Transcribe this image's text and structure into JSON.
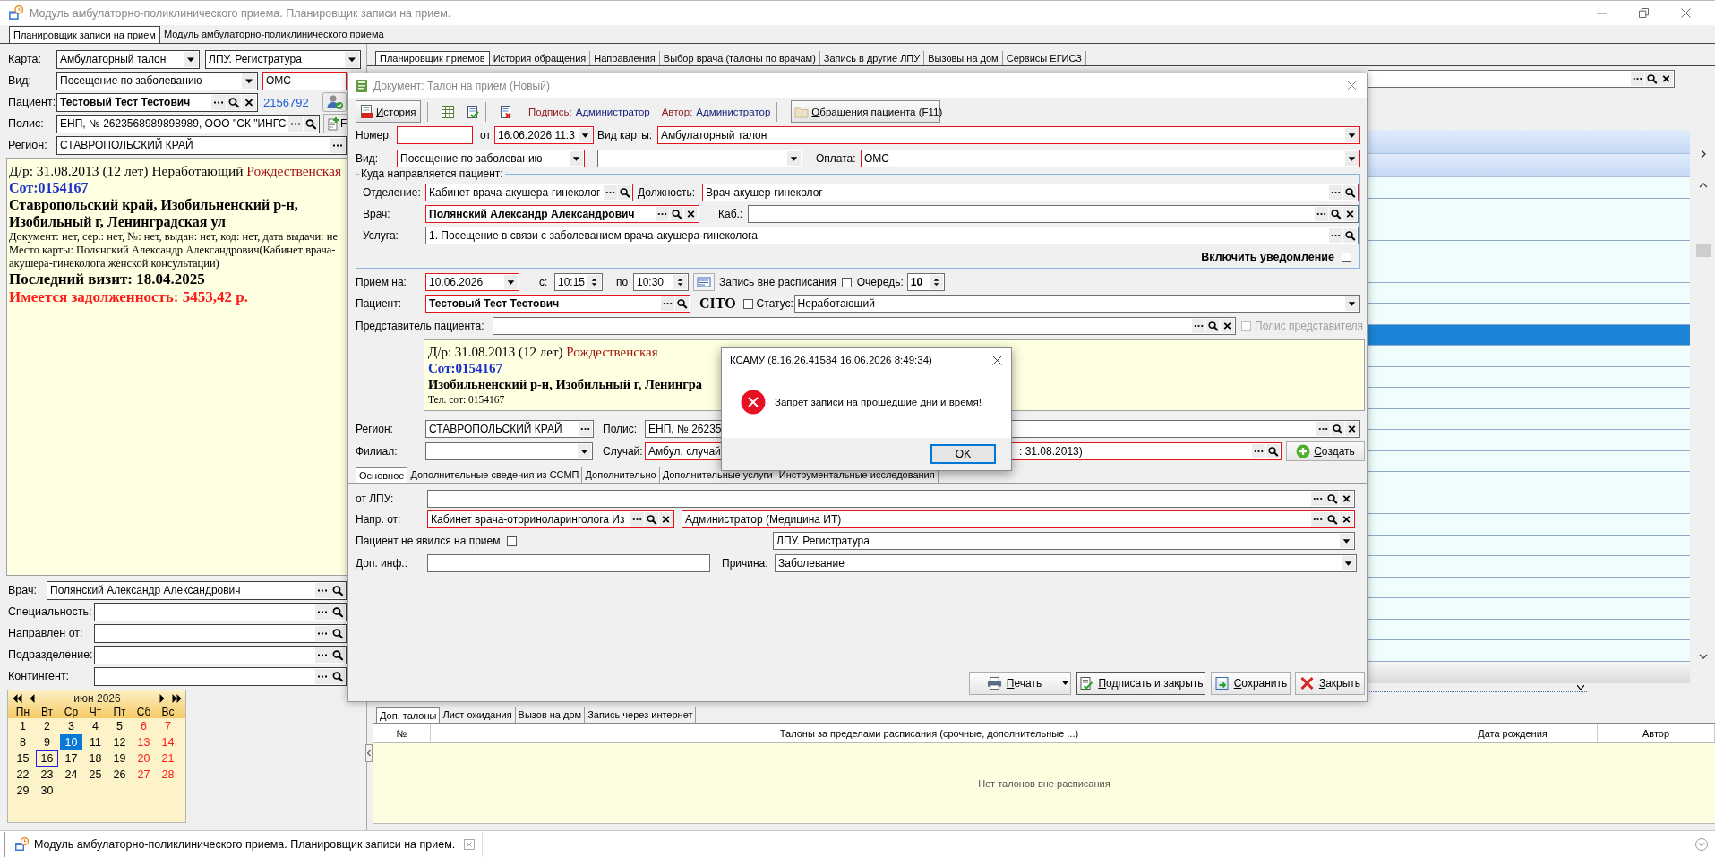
{
  "window": {
    "title": "Модуль амбулаторно-поликлинического приема. Планировщик записи на прием."
  },
  "module_tabs": [
    {
      "label": "Планировщик записи на прием",
      "selected": true
    },
    {
      "label": "Модуль амбулаторно-поликлинического приема",
      "selected": false
    }
  ],
  "filters": {
    "card": {
      "label": "Карта:",
      "value": "Амбулаторный талон",
      "required": false
    },
    "lpu": {
      "value": "ЛПУ. Регистратура",
      "required": false
    },
    "visit_type": {
      "label": "Вид:",
      "value": "Посещение по заболеванию",
      "required": false
    },
    "payment": {
      "value": "ОМС",
      "required": true
    },
    "patient": {
      "label": "Пациент:",
      "value": "Тестовый Тест Тестович",
      "required": false
    },
    "patient_id": "2156792",
    "policy": {
      "label": "Полис:",
      "value": "ЕНП, № 2623568989898989, ООО \"СК \"ИНГС",
      "required": false
    },
    "policy_button": "F",
    "region": {
      "label": "Регион:",
      "value": "СТАВРОПОЛЬСКИЙ КРАЙ",
      "required": false
    }
  },
  "patient_info": [
    {
      "kind": "birth",
      "text": "Д/р: 31.08.2013 (12 лет) Неработающий",
      "place": "Рождественская"
    },
    {
      "kind": "phone",
      "text": "Сот:0154167"
    },
    {
      "kind": "address",
      "text": "Ставропольский край, Изобильненский р-н, Изобильный г, Ленинградская ул"
    },
    {
      "kind": "note",
      "text": "Документ: нет, сер.: нет, №: нет, выдан: нет, код: нет, дата выдачи: не"
    },
    {
      "kind": "note",
      "text": "Место карты: Полянский Александр Александрович(Кабинет врача-акушера-гинеколога женской консультации)"
    },
    {
      "kind": "visit",
      "text": "Последний визит: 18.04.2025"
    },
    {
      "kind": "debt",
      "text": "Имеется задолженность: 5453,42 р."
    }
  ],
  "doctor_filters": [
    {
      "label": "Врач:",
      "value": "Полянский Александр Александрович",
      "required": false
    },
    {
      "label": "Специальность:",
      "required": false
    },
    {
      "label": "Направлен от:",
      "required": false
    },
    {
      "label": "Подразделение:",
      "required": false
    },
    {
      "label": "Контингент:",
      "required": false
    }
  ],
  "calendar": {
    "month": "июн 2026",
    "weekdays": [
      {
        "label": "Пн",
        "weekend": false
      },
      {
        "label": "Вт",
        "weekend": false
      },
      {
        "label": "Ср",
        "weekend": false
      },
      {
        "label": "Чт",
        "weekend": false
      },
      {
        "label": "Пт",
        "weekend": false
      },
      {
        "label": "Сб",
        "weekend": true
      },
      {
        "label": "Вс",
        "weekend": true
      }
    ],
    "weeks": [
      [
        {
          "day": "1",
          "selected": false,
          "today": false
        },
        {
          "day": "2",
          "selected": false,
          "today": false
        },
        {
          "day": "3",
          "selected": false,
          "today": false
        },
        {
          "day": "4",
          "selected": false,
          "today": false
        },
        {
          "day": "5",
          "selected": false,
          "today": false
        },
        {
          "day": "6",
          "selected": false,
          "today": false
        },
        {
          "day": "7",
          "selected": false,
          "today": false
        }
      ],
      [
        {
          "day": "8",
          "selected": false,
          "today": false
        },
        {
          "day": "9",
          "selected": false,
          "today": false
        },
        {
          "day": "10",
          "selected": true,
          "today": false
        },
        {
          "day": "11",
          "selected": false,
          "today": false
        },
        {
          "day": "12",
          "selected": false,
          "today": false
        },
        {
          "day": "13",
          "selected": false,
          "today": false
        },
        {
          "day": "14",
          "selected": false,
          "today": false
        }
      ],
      [
        {
          "day": "15",
          "selected": false,
          "today": false
        },
        {
          "day": "16",
          "selected": false,
          "today": true
        },
        {
          "day": "17",
          "selected": false,
          "today": false
        },
        {
          "day": "18",
          "selected": false,
          "today": false
        },
        {
          "day": "19",
          "selected": false,
          "today": false
        },
        {
          "day": "20",
          "selected": false,
          "today": false
        },
        {
          "day": "21",
          "selected": false,
          "today": false
        }
      ],
      [
        {
          "day": "22",
          "selected": false,
          "today": false
        },
        {
          "day": "23",
          "selected": false,
          "today": false
        },
        {
          "day": "24",
          "selected": false,
          "today": false
        },
        {
          "day": "25",
          "selected": false,
          "today": false
        },
        {
          "day": "26",
          "selected": false,
          "today": false
        },
        {
          "day": "27",
          "selected": false,
          "today": false
        },
        {
          "day": "28",
          "selected": false,
          "today": false
        }
      ],
      [
        {
          "day": "29",
          "selected": false,
          "today": false
        },
        {
          "day": "30",
          "selected": false,
          "today": false
        }
      ]
    ]
  },
  "planner_tabs": [
    {
      "label": "Планировщик приемов",
      "selected": true
    },
    {
      "label": "История обращения",
      "selected": false
    },
    {
      "label": "Направления",
      "selected": false
    },
    {
      "label": "Выбор врача (талоны по врачам)",
      "selected": false
    },
    {
      "label": "Запись в другие ЛПУ",
      "selected": false
    },
    {
      "label": "Вызовы на дом",
      "selected": false
    },
    {
      "label": "Сервисы ЕГИСЗ",
      "selected": false
    }
  ],
  "schedule_grid": {
    "rows": [
      {
        "selected": false
      },
      {
        "selected": false
      },
      {
        "selected": false
      },
      {
        "selected": false
      },
      {
        "selected": false
      },
      {
        "selected": false
      },
      {
        "selected": false
      },
      {
        "selected": true
      },
      {
        "selected": false
      },
      {
        "selected": false
      },
      {
        "selected": false
      },
      {
        "selected": false
      },
      {
        "selected": false
      },
      {
        "selected": false
      },
      {
        "selected": false
      },
      {
        "selected": false
      },
      {
        "selected": false
      },
      {
        "selected": false
      },
      {
        "selected": false
      },
      {
        "selected": false
      },
      {
        "selected": false
      },
      {
        "selected": false
      },
      {
        "selected": false
      }
    ]
  },
  "extra_tabs": [
    {
      "label": "Доп. талоны",
      "selected": true
    },
    {
      "label": "Лист ожидания",
      "selected": false
    },
    {
      "label": "Вызов на дом",
      "selected": false
    },
    {
      "label": "Запись через интернет",
      "selected": false
    }
  ],
  "extra_table": {
    "columns": [
      "№",
      "Талоны за пределами расписания (срочные, дополнительные ...)",
      "Дата рождения",
      "Автор"
    ],
    "empty_text": "Нет талонов вне расписания"
  },
  "dialog": {
    "title": "Документ: Талон на прием (Новый)",
    "toolbar": {
      "history": "История",
      "signature_label": "Подпись:",
      "signature": "Администратор",
      "author_label": "Автор:",
      "author": "Администратор",
      "visits": "Обращения пациента (F11)"
    },
    "number": {
      "label": "Номер:",
      "required": true
    },
    "date": {
      "label": "от",
      "value": "16.06.2026 11:3",
      "required": true
    },
    "card_type": {
      "label": "Вид карты:",
      "value": "Амбулаторный талон",
      "required": true
    },
    "visit_type": {
      "label": "Вид:",
      "value": "Посещение по заболеванию",
      "required": true
    },
    "visit_subtype": {
      "required": false
    },
    "payment": {
      "label": "Оплата:",
      "value": "ОМС",
      "required": true
    },
    "destination": {
      "title": "Куда направляется пациент:",
      "department": {
        "label": "Отделение:",
        "value": "Кабинет врача-акушера-гинеколог",
        "required": true
      },
      "position": {
        "label": "Должность:",
        "value": "Врач-акушер-гинеколог",
        "required": true
      },
      "doctor": {
        "label": "Врач:",
        "value": "Полянский Александр Александрович",
        "required": true
      },
      "cabinet": {
        "label": "Каб.:",
        "required": false
      },
      "service": {
        "label": "Услуга:",
        "value": "1. Посещение в связи с заболеванием врача-акушера-гинеколога",
        "required": false
      },
      "notify": {
        "label": "Включить уведомление",
        "checked": false
      }
    },
    "appointment_date": {
      "label": "Прием на:",
      "value": "10.06.2026",
      "required": true
    },
    "time_from": {
      "label": "с:",
      "value": "10:15"
    },
    "time_to": {
      "label": "по",
      "value": "10:30"
    },
    "unscheduled": {
      "label": "Запись вне расписания",
      "checked": false
    },
    "queue": {
      "label": "Очередь:",
      "value": "10"
    },
    "patient": {
      "label": "Пациент:",
      "value": "Тестовый Тест Тестович",
      "required": true
    },
    "cito": {
      "label": "CITO",
      "checked": false
    },
    "status": {
      "label": "Статус:",
      "value": "Неработающий",
      "required": false
    },
    "representative": {
      "label": "Представитель пациента:",
      "required": false
    },
    "representative_policy": {
      "label": "Полис представителя",
      "checked": false,
      "disabled": true
    },
    "patient_info": [
      {
        "kind": "birth",
        "text": "Д/р: 31.08.2013 (12 лет)",
        "place": "Рождественская"
      },
      {
        "kind": "phone",
        "text": "Сот:0154167"
      },
      {
        "kind": "address",
        "text": "Изобильненский р-н, Изобильный г, Ленингра"
      },
      {
        "kind": "small",
        "text": "Тел. сот: 0154167"
      }
    ],
    "region": {
      "label": "Регион:",
      "value": "СТАВРОПОЛЬСКИЙ КРАЙ",
      "required": false
    },
    "policy": {
      "label": "Полис:",
      "value": "ЕНП, № 26235",
      "required": false
    },
    "branch": {
      "label": "Филиал:",
      "required": false
    },
    "case": {
      "label": "Случай:",
      "value": "Амбул. случай",
      "value_end": ": 31.08.2013)",
      "required": true
    },
    "create": "Создать",
    "tabs": [
      {
        "label": "Основное",
        "selected": true
      },
      {
        "label": "Дополнительные сведения из ССМП",
        "selected": false
      },
      {
        "label": "Дополнительно",
        "selected": false
      },
      {
        "label": "Дополнительные услуги",
        "selected": false
      },
      {
        "label": "Инструментальные исследования",
        "selected": false
      }
    ],
    "from_lpu": {
      "label": "от ЛПУ:",
      "required": false
    },
    "referred_by": {
      "label": "Напр. от:",
      "value": "Кабинет врача-оториноларинголога Из",
      "required": true
    },
    "referrer": {
      "value": "Администратор (Медицина ИТ)",
      "required": true
    },
    "no_show": {
      "label": "Пациент не явился на прием",
      "checked": false
    },
    "lpu": {
      "value": "ЛПУ. Регистратура",
      "required": false
    },
    "extra_info": {
      "label": "Доп. инф.:",
      "required": false
    },
    "reason": {
      "label": "Причина:",
      "value": "Заболевание",
      "required": false
    },
    "buttons": [
      {
        "kind": "print",
        "label": "Печать"
      },
      {
        "kind": "sign",
        "label": "Подписать и закрыть"
      },
      {
        "kind": "save",
        "label": "Сохранить"
      },
      {
        "kind": "close",
        "label": "Закрыть"
      }
    ]
  },
  "message_box": {
    "title": "КСАМУ (8.16.26.41584 16.06.2026 8:49:34)",
    "text": "Запрет записи на прошедшие дни и время!",
    "button": "OK"
  },
  "status_bar": {
    "document_tab": "Модуль амбулаторно-поликлинического приема. Планировщик записи на прием."
  }
}
